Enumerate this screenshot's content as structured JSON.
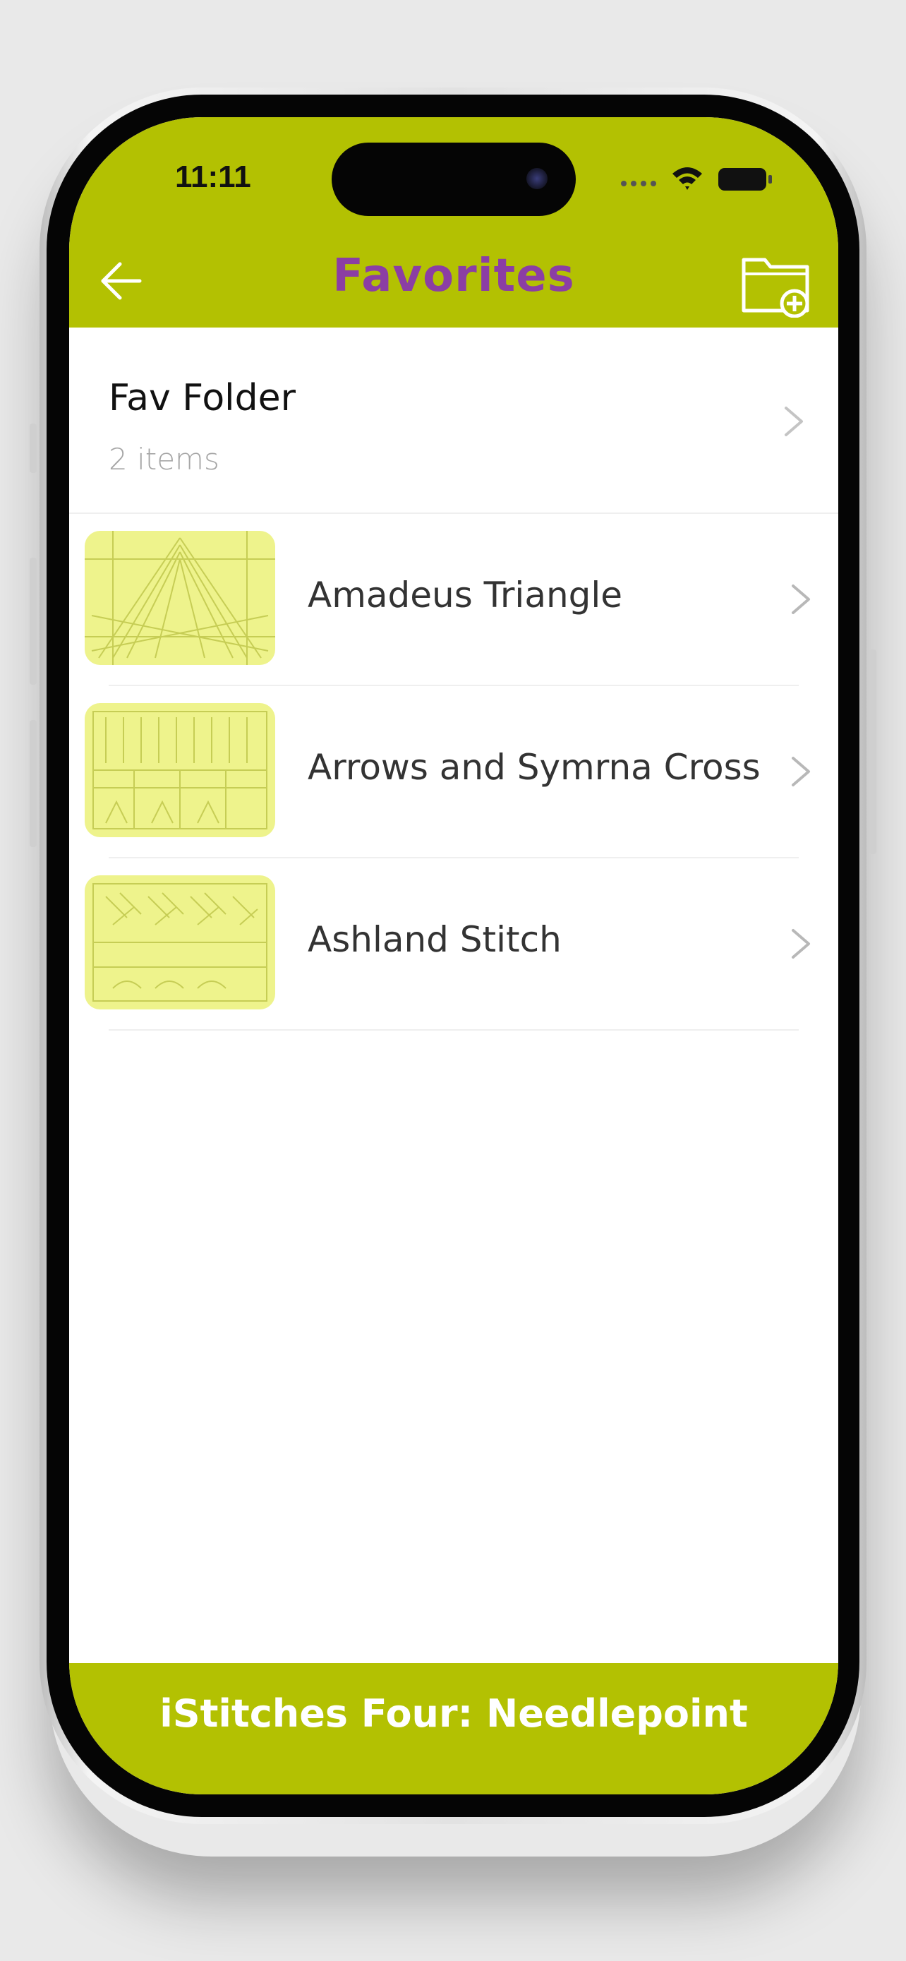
{
  "status_bar": {
    "time": "11:11",
    "signal_icon": "cellular-dots-icon",
    "wifi_icon": "wifi-icon",
    "battery_icon": "battery-icon"
  },
  "nav": {
    "title": "Favorites",
    "back_icon": "arrow-left-icon",
    "add_folder_icon": "folder-add-icon"
  },
  "folders": [
    {
      "name": "Fav Folder",
      "count": "2 items"
    }
  ],
  "items": [
    {
      "label": "Amadeus Triangle",
      "thumbnail": "stitch-pattern-thumbnail"
    },
    {
      "label": "Arrows and Symrna Cross",
      "thumbnail": "stitch-pattern-thumbnail"
    },
    {
      "label": "Ashland Stitch",
      "thumbnail": "stitch-pattern-thumbnail"
    }
  ],
  "footer": {
    "text": "iStitches Four: Needlepoint"
  },
  "colors": {
    "accent": "#b3c102",
    "title": "#8b3ea4",
    "thumbnail_bg": "#eef38c"
  }
}
